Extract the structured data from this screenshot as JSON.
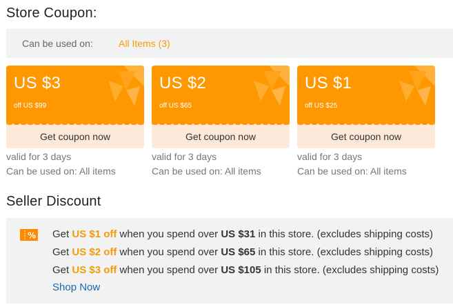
{
  "store_coupon": {
    "title": "Store Coupon:",
    "filter_label": "Can be used on:",
    "filter_value": "All Items (3)",
    "coupons": [
      {
        "amount": "US $3",
        "min_spend": "off US $99",
        "button": "Get coupon now",
        "validity": "valid for 3 days",
        "usage": "Can be used on: All items"
      },
      {
        "amount": "US $2",
        "min_spend": "off US $65",
        "button": "Get coupon now",
        "validity": "valid for 3 days",
        "usage": "Can be used on: All items"
      },
      {
        "amount": "US $1",
        "min_spend": "off US $25",
        "button": "Get coupon now",
        "validity": "valid for 3 days",
        "usage": "Can be used on: All items"
      }
    ]
  },
  "seller_discount": {
    "title": "Seller Discount",
    "icon": "percent-icon",
    "lines": [
      {
        "prefix": "Get",
        "discount": "US $1 off",
        "middle": "when you spend over",
        "threshold": "US $31",
        "suffix": "in this store. (excludes shipping costs)"
      },
      {
        "prefix": "Get",
        "discount": "US $2 off",
        "middle": "when you spend over",
        "threshold": "US $65",
        "suffix": "in this store. (excludes shipping costs)"
      },
      {
        "prefix": "Get",
        "discount": "US $3 off",
        "middle": "when you spend over",
        "threshold": "US $105",
        "suffix": "in this store. (excludes shipping costs)"
      }
    ],
    "shop_now": "Shop Now"
  },
  "colors": {
    "accent": "#ff9800",
    "highlight": "#f29c0a",
    "link": "#1a66b3",
    "coupon_button_bg": "#fde9d9"
  }
}
